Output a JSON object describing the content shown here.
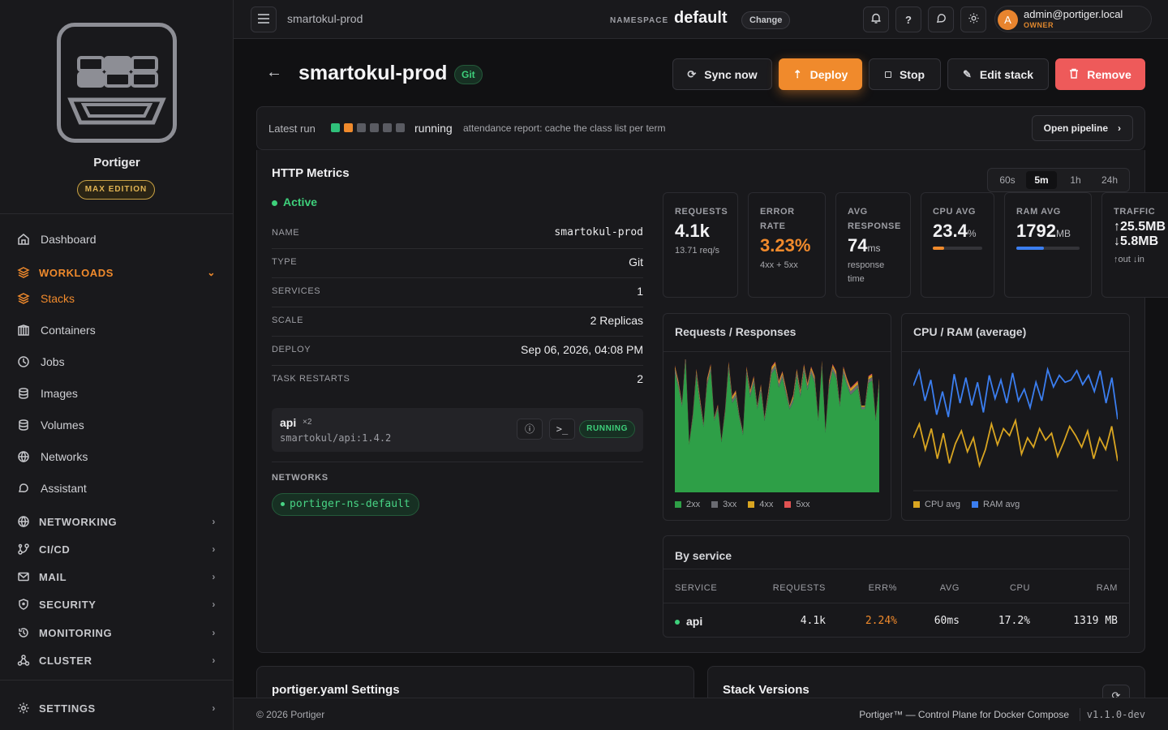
{
  "sidebar": {
    "brand": "Portiger",
    "edition": "MAX EDITION",
    "items": [
      {
        "label": "Dashboard",
        "icon": "home-icon"
      },
      {
        "label": "WORKLOADS",
        "icon": "layers-icon"
      },
      {
        "label": "Stacks",
        "icon": "layers-icon"
      },
      {
        "label": "Containers",
        "icon": "box-icon"
      },
      {
        "label": "Jobs",
        "icon": "clock-icon"
      },
      {
        "label": "Images",
        "icon": "database-icon"
      },
      {
        "label": "Volumes",
        "icon": "database-icon"
      },
      {
        "label": "Networks",
        "icon": "globe-icon"
      },
      {
        "label": "Assistant",
        "icon": "chat-icon"
      },
      {
        "label": "NETWORKING",
        "icon": "globe-icon"
      },
      {
        "label": "CI/CD",
        "icon": "git-icon"
      },
      {
        "label": "MAIL",
        "icon": "mail-icon"
      },
      {
        "label": "SECURITY",
        "icon": "shield-icon"
      },
      {
        "label": "MONITORING",
        "icon": "history-icon"
      },
      {
        "label": "CLUSTER",
        "icon": "cluster-icon"
      },
      {
        "label": "SETTINGS",
        "icon": "gear-icon"
      }
    ]
  },
  "topbar": {
    "breadcrumb": "smartokul-prod",
    "namespace_label": "NAMESPACE",
    "namespace": "default",
    "change_label": "Change",
    "user_initial": "A",
    "user_email": "admin@portiger.local",
    "user_role": "OWNER"
  },
  "header": {
    "title": "smartokul-prod",
    "badge": "Git",
    "actions": {
      "sync": "Sync now",
      "deploy": "Deploy",
      "stop": "Stop",
      "edit": "Edit stack",
      "remove": "Remove"
    }
  },
  "latest_run": {
    "label": "Latest run",
    "status": "running",
    "message": "attendance report: cache the class list per term",
    "open_pipeline": "Open pipeline",
    "steps": [
      "#2fc07a",
      "#f08a2c",
      "#5a5b62",
      "#5a5b62",
      "#5a5b62",
      "#5a5b62"
    ]
  },
  "metrics": {
    "title": "HTTP Metrics",
    "status": "Active",
    "details": [
      {
        "key": "NAME",
        "value": "smartokul-prod"
      },
      {
        "key": "TYPE",
        "value": "Git"
      },
      {
        "key": "SERVICES",
        "value": "1"
      },
      {
        "key": "SCALE",
        "value": "2 Replicas"
      },
      {
        "key": "DEPLOY",
        "value": "Sep 06, 2026, 04:08 PM"
      },
      {
        "key": "TASK RESTARTS",
        "value": "2"
      }
    ],
    "service": {
      "name": "api",
      "replicas": "×2",
      "image": "smartokul/api:1.4.2",
      "status": "RUNNING"
    },
    "networks_label": "NETWORKS",
    "network": "portiger-ns-default",
    "ranges": [
      "60s",
      "5m",
      "1h",
      "24h"
    ],
    "selected_range": "5m",
    "cards": {
      "requests": {
        "label": "REQUESTS",
        "value": "4.1k",
        "sub": "13.71 req/s"
      },
      "error_rate": {
        "label1": "ERROR",
        "label2": "RATE",
        "value": "3.23%",
        "sub": "4xx + 5xx"
      },
      "avg_response": {
        "label1": "AVG",
        "label2": "RESPONSE",
        "value": "74",
        "unit": "ms",
        "sub1": "response",
        "sub2": "time"
      },
      "cpu_avg": {
        "label": "CPU AVG",
        "value": "23.4",
        "unit": "%",
        "fill": 0.234
      },
      "ram_avg": {
        "label": "RAM AVG",
        "value": "1792",
        "unit": "MB",
        "fill": 0.43
      },
      "traffic": {
        "label": "TRAFFIC",
        "out": "↑25.5MB",
        "in": "↓5.8MB",
        "sub": "↑out ↓in"
      }
    },
    "req_chart": {
      "title": "Requests / Responses",
      "legend": [
        "2xx",
        "3xx",
        "4xx",
        "5xx"
      ],
      "colors": [
        "#2e9f47",
        "#6a6b72",
        "#d9a521",
        "#e05252"
      ]
    },
    "cpu_chart": {
      "title": "CPU / RAM (average)",
      "legend": [
        "CPU avg",
        "RAM avg"
      ],
      "colors": [
        "#d9a521",
        "#3b7ef0"
      ]
    },
    "by_service": {
      "title": "By service",
      "headers": [
        "SERVICE",
        "REQUESTS",
        "ERR%",
        "AVG",
        "CPU",
        "RAM"
      ],
      "rows": [
        {
          "service": "api",
          "requests": "4.1k",
          "err": "2.24%",
          "avg": "60ms",
          "cpu": "17.2%",
          "ram": "1319 MB"
        }
      ]
    }
  },
  "chart_data": [
    {
      "type": "area",
      "title": "Requests / Responses",
      "series": [
        {
          "name": "2xx",
          "values": [
            100,
            88,
            72,
            110,
            40,
            62,
            98,
            74,
            55,
            90,
            102,
            60,
            70,
            42,
            66,
            104,
            75,
            80,
            62,
            48,
            100,
            80,
            92,
            70,
            85,
            60,
            78,
            100,
            104,
            88,
            96,
            82,
            70,
            76,
            98,
            80,
            102,
            86,
            100,
            92,
            60,
            105,
            50,
            88,
            102,
            96,
            72,
            100,
            90,
            82,
            85,
            88,
            70,
            70,
            92,
            94,
            60,
            90
          ]
        },
        {
          "name": "3xx",
          "values": [
            4,
            3,
            2,
            4,
            1,
            2,
            3,
            3,
            2,
            3,
            3,
            2,
            2,
            1,
            2,
            3,
            3,
            3,
            2,
            2,
            3,
            3,
            3,
            2,
            3,
            2,
            3,
            3,
            3,
            3,
            3,
            3,
            2,
            3,
            3,
            3,
            3,
            3,
            3,
            3,
            2,
            3,
            2,
            3,
            3,
            3,
            2,
            3,
            3,
            3,
            3,
            3,
            2,
            2,
            3,
            3,
            2,
            3
          ]
        },
        {
          "name": "4xx",
          "values": [
            2,
            2,
            1,
            2,
            1,
            1,
            2,
            2,
            1,
            2,
            2,
            1,
            1,
            1,
            1,
            2,
            2,
            2,
            1,
            1,
            2,
            2,
            2,
            1,
            2,
            1,
            2,
            2,
            2,
            2,
            2,
            2,
            1,
            2,
            2,
            2,
            2,
            2,
            2,
            2,
            1,
            2,
            1,
            2,
            2,
            2,
            1,
            2,
            2,
            2,
            2,
            2,
            1,
            1,
            2,
            2,
            1,
            2
          ]
        },
        {
          "name": "5xx",
          "values": [
            1,
            1,
            0,
            1,
            0,
            1,
            1,
            1,
            0,
            1,
            1,
            0,
            1,
            0,
            1,
            1,
            1,
            1,
            0,
            0,
            1,
            1,
            1,
            0,
            1,
            0,
            1,
            1,
            1,
            1,
            1,
            1,
            0,
            1,
            1,
            1,
            1,
            1,
            1,
            1,
            0,
            1,
            0,
            1,
            1,
            1,
            0,
            1,
            1,
            1,
            1,
            1,
            0,
            0,
            1,
            1,
            0,
            1
          ]
        }
      ]
    },
    {
      "type": "line",
      "title": "CPU / RAM (average)",
      "series": [
        {
          "name": "CPU avg",
          "values": [
            40,
            52,
            30,
            48,
            22,
            44,
            18,
            35,
            46,
            28,
            40,
            16,
            30,
            52,
            34,
            48,
            42,
            55,
            26,
            40,
            32,
            48,
            38,
            44,
            24,
            36,
            50,
            42,
            32,
            46,
            22,
            40,
            30,
            50,
            20
          ]
        },
        {
          "name": "RAM avg",
          "values": [
            85,
            98,
            72,
            90,
            60,
            80,
            58,
            95,
            70,
            92,
            68,
            88,
            62,
            94,
            74,
            90,
            70,
            96,
            72,
            82,
            66,
            88,
            72,
            99,
            84,
            94,
            88,
            90,
            98,
            86,
            94,
            80,
            98,
            70,
            92,
            56
          ]
        }
      ]
    }
  ],
  "footer": {
    "copyright": "© 2026 Portiger",
    "tagline": "Portiger™ — Control Plane for Docker Compose",
    "version": "v1.1.0-dev"
  },
  "bottom": {
    "settings_title": "portiger.yaml Settings",
    "versions_title": "Stack Versions"
  }
}
